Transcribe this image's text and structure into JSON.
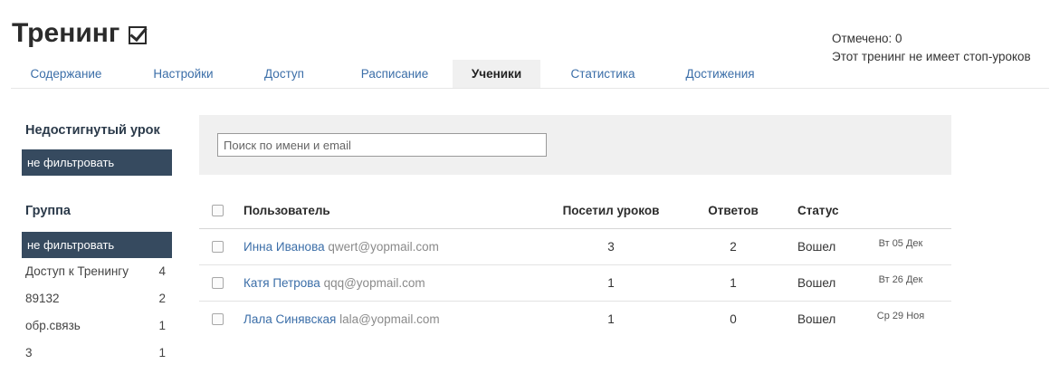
{
  "page": {
    "title": "Тренинг",
    "checked_label": "Отмечено: 0",
    "stop_lessons_note": "Этот тренинг не имеет стоп-уроков"
  },
  "tabs": [
    {
      "label": "Содержание",
      "active": false
    },
    {
      "label": "Настройки",
      "active": false
    },
    {
      "label": "Доступ",
      "active": false
    },
    {
      "label": "Расписание",
      "active": false
    },
    {
      "label": "Ученики",
      "active": true
    },
    {
      "label": "Статистика",
      "active": false
    },
    {
      "label": "Достижения",
      "active": false
    }
  ],
  "sidebar": {
    "lesson_filter": {
      "heading": "Недостигнутый урок",
      "selected": "не фильтровать"
    },
    "group_filter": {
      "heading": "Группа",
      "selected": "не фильтровать",
      "items": [
        {
          "name": "Доступ к Тренингу",
          "count": "4"
        },
        {
          "name": "89132",
          "count": "2"
        },
        {
          "name": "обр.связь",
          "count": "1"
        },
        {
          "name": "3",
          "count": "1"
        }
      ]
    }
  },
  "search": {
    "placeholder": "Поиск по имени и email",
    "value": ""
  },
  "table": {
    "headers": {
      "user": "Пользователь",
      "visits": "Посетил уроков",
      "answers": "Ответов",
      "status": "Статус"
    },
    "rows": [
      {
        "name": "Инна Иванова",
        "email": "qwert@yopmail.com",
        "visits": "3",
        "answers": "2",
        "status": "Вошел",
        "date": "Вт 05 Дек"
      },
      {
        "name": "Катя Петрова",
        "email": "qqq@yopmail.com",
        "visits": "1",
        "answers": "1",
        "status": "Вошел",
        "date": "Вт 26 Дек"
      },
      {
        "name": "Лала Синявская",
        "email": "lala@yopmail.com",
        "visits": "1",
        "answers": "0",
        "status": "Вошел",
        "date": "Ср 29 Ноя"
      }
    ]
  },
  "colors": {
    "accent_link": "#3b6ea8",
    "filter_bg": "#364a5f",
    "panel_bg": "#f0f0f0"
  }
}
